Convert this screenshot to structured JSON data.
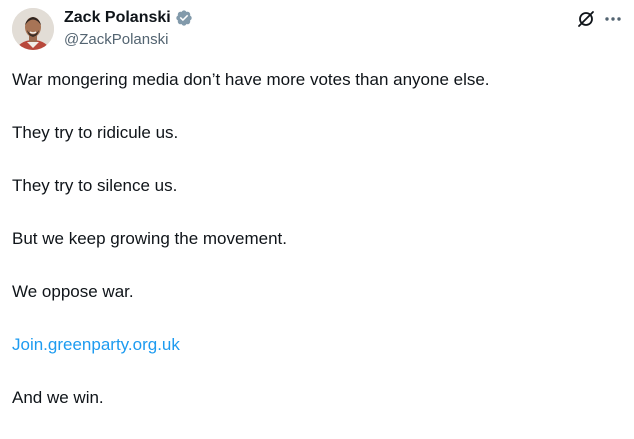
{
  "author": {
    "display_name": "Zack Polanski",
    "handle": "@ZackPolanski",
    "verified": true
  },
  "icons": {
    "avatar": "profile-photo",
    "badge": "verified-badge-icon",
    "grok": "grok-icon",
    "more": "more-options-icon"
  },
  "colors": {
    "text": "#0f1419",
    "secondary": "#536471",
    "link": "#1d9bf0",
    "badge": "#829aab"
  },
  "tweet": {
    "paragraphs": [
      "War mongering media don’t have more votes than anyone else.",
      "They try to ridicule us.",
      "They try to silence us.",
      "But we keep growing the movement.",
      "We oppose war."
    ],
    "link": "Join.greenparty.org.uk",
    "closing": "And we win."
  }
}
